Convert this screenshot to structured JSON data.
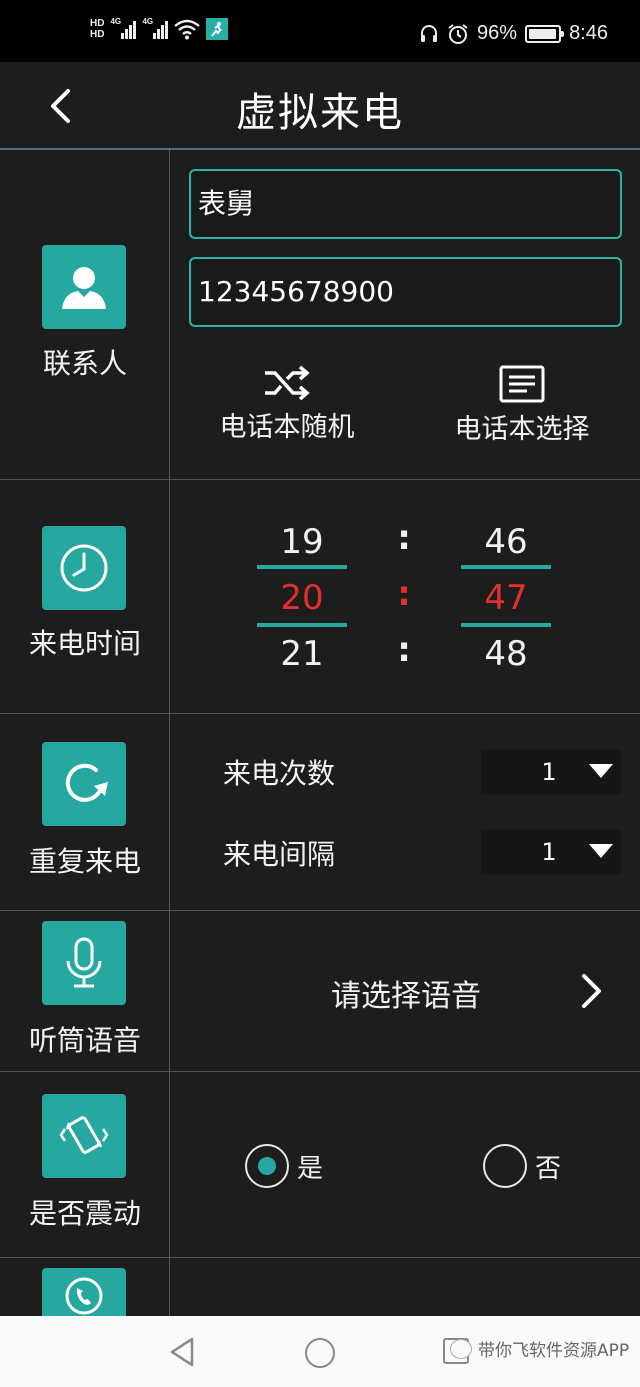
{
  "status_bar": {
    "hd_1": "HD",
    "hd_2": "HD",
    "net_1": "4G",
    "net_2": "4G",
    "battery_text": "96%",
    "battery_level": 0.96,
    "time": "8:46"
  },
  "header": {
    "title": "虚拟来电"
  },
  "contact": {
    "label": "联系人",
    "name_value": "表舅",
    "number_value": "12345678900",
    "random_label": "电话本随机",
    "select_label": "电话本选择"
  },
  "call_time": {
    "label": "来电时间",
    "hours": [
      "19",
      "20",
      "21"
    ],
    "minutes": [
      "46",
      "47",
      "48"
    ],
    "colon": ":"
  },
  "repeat": {
    "label": "重复来电",
    "count_label": "来电次数",
    "count_value": "1",
    "interval_label": "来电间隔",
    "interval_value": "1"
  },
  "voice": {
    "label": "听筒语音",
    "select_text": "请选择语音"
  },
  "vibrate": {
    "label": "是否震动",
    "yes_label": "是",
    "no_label": "否",
    "selected": "yes"
  },
  "colors": {
    "accent": "#26a8a0",
    "selected_time": "#e23030",
    "background": "#1d1d1d"
  },
  "nav": {
    "watermark": "带你飞软件资源APP"
  }
}
